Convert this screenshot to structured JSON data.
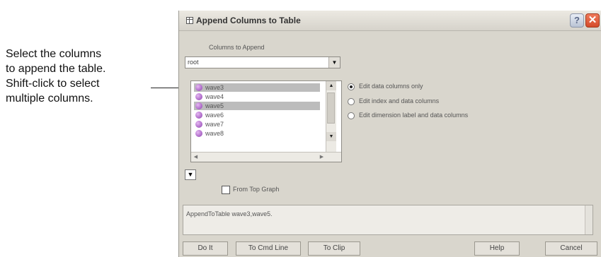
{
  "callout": {
    "lines": [
      "Select the columns",
      "to append the table.",
      "Shift-click to select",
      "multiple columns."
    ]
  },
  "dialog": {
    "title": "Append Columns to Table",
    "title_icon": "table-icon",
    "help_icon": "question-icon",
    "close_icon": "close-icon",
    "help_symbol": "?",
    "close_symbol": "✕"
  },
  "columns_section": {
    "label": "Columns to Append",
    "folder_value": "root"
  },
  "wave_list": {
    "items": [
      {
        "label": "wave3",
        "selected": true
      },
      {
        "label": "wave4",
        "selected": false
      },
      {
        "label": "wave5",
        "selected": true
      },
      {
        "label": "wave6",
        "selected": false
      },
      {
        "label": "wave7",
        "selected": false
      },
      {
        "label": "wave8",
        "selected": false
      }
    ]
  },
  "edit_options": {
    "selected_index": 0,
    "items": [
      "Edit data columns only",
      "Edit index and data columns",
      "Edit dimension label and data columns"
    ]
  },
  "from_top_graph": {
    "label": "From Top Graph",
    "checked": false
  },
  "command": {
    "text": "AppendToTable wave3,wave5."
  },
  "buttons": {
    "do_it": "Do It",
    "to_cmd_line": "To Cmd Line",
    "to_clip": "To Clip",
    "help": "Help",
    "cancel": "Cancel"
  },
  "colors": {
    "dialog_bg": "#d9d6cd",
    "selection": "#bcbcbc",
    "close_accent": "#d44a2a"
  }
}
